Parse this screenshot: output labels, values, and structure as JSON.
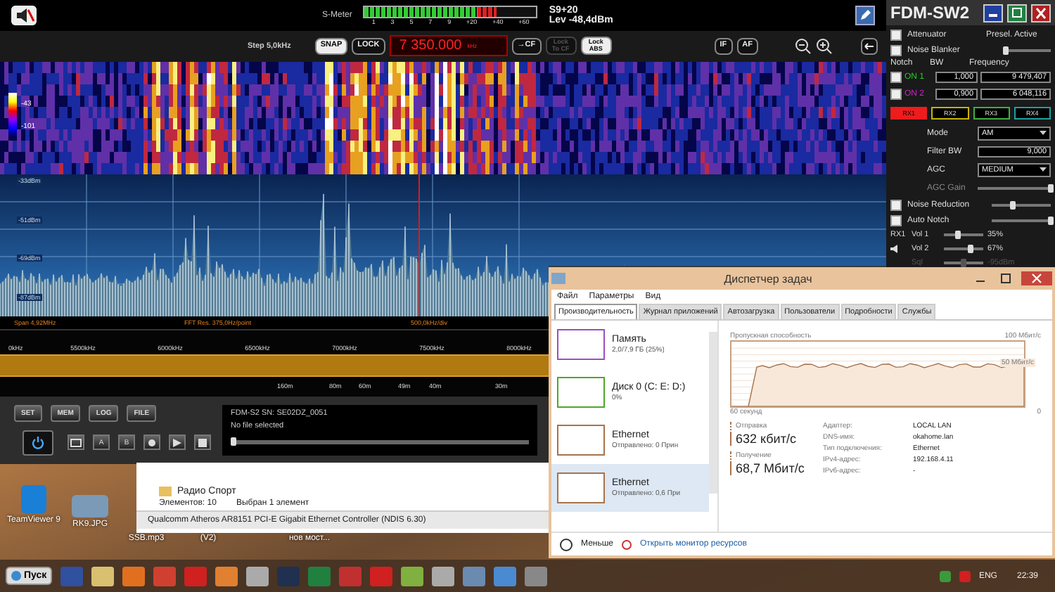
{
  "sdr": {
    "meter": {
      "label": "S-Meter",
      "level": 0.77,
      "scale": [
        "1",
        "3",
        "5",
        "7",
        "9",
        "+20",
        "+40",
        "+60"
      ],
      "reading": "S9+20",
      "level_text": "Lev -48,4dBm"
    },
    "toolbar": {
      "step": "Step 5,0kHz",
      "toggles": [
        {
          "label": "SNAP",
          "on": true
        },
        {
          "label": "LOCK",
          "on": false
        }
      ],
      "frequency": "7 350.000",
      "unit": "kHz",
      "cf_button": "→CF",
      "locks": [
        {
          "label": "Lock To CF",
          "on": false,
          "disabled": true
        },
        {
          "label": "Lock ABS",
          "on": true,
          "disabled": false
        }
      ],
      "if_button": "IF",
      "af_button": "AF"
    },
    "waterfall": {
      "legend": [
        "-43",
        "-101"
      ]
    },
    "spectrum": {
      "db_labels": [
        "-33dBm",
        "-51dBm",
        "-69dBm",
        "-87dBm"
      ],
      "span": "Span 4,92MHz",
      "fft": "FFT Res. 375,0Hz/point",
      "div": "500,0kHz/div",
      "freq_labels": [
        "0kHz",
        "5500kHz",
        "6000kHz",
        "6500kHz",
        "7000kHz",
        "7500kHz",
        "8000kHz"
      ],
      "bands": [
        "160m",
        "80m",
        "60m",
        "49m",
        "40m",
        "30m"
      ]
    },
    "controls": {
      "buttons": [
        "SET",
        "MEM",
        "LOG",
        "FILE"
      ],
      "transport": [
        "A",
        "B"
      ],
      "device": "FDM-S2 SN: SE02DZ_0051",
      "file": "No file selected",
      "playback": {
        "level": 0.0
      }
    },
    "panel": {
      "title": "FDM-SW2",
      "options": [
        {
          "label": "Attenuator",
          "checked": false
        },
        {
          "label": "Noise Blanker",
          "checked": false
        }
      ],
      "presel": {
        "label": "Presel. Active",
        "level": 0.0
      },
      "notch_headers": [
        "Notch",
        "BW",
        "Frequency"
      ],
      "notches": [
        {
          "label": "ON 1",
          "color": "#22cc22",
          "checked": false,
          "bw": "1,000",
          "frequency": "9 479,407"
        },
        {
          "label": "ON 2",
          "color": "#cc22cc",
          "checked": false,
          "bw": "0,900",
          "frequency": "6 048,116"
        }
      ],
      "receivers": [
        {
          "label": "RX1",
          "selected": true,
          "color": "#ee1c1c"
        },
        {
          "label": "RX2",
          "selected": false,
          "color": "#c8b400"
        },
        {
          "label": "RX3",
          "selected": false,
          "color": "#40b040"
        },
        {
          "label": "RX4",
          "selected": false,
          "color": "#20a0a0"
        }
      ],
      "settings": [
        {
          "label": "Mode",
          "kind": "dropdown",
          "value": "AM"
        },
        {
          "label": "Filter BW",
          "kind": "spin",
          "value": "9,000"
        },
        {
          "label": "AGC",
          "kind": "dropdown",
          "value": "MEDIUM"
        },
        {
          "label": "AGC Gain",
          "kind": "slider",
          "level": 1.0
        }
      ],
      "filters": [
        {
          "label": "Noise Reduction",
          "checked": false,
          "level": 0.35
        },
        {
          "label": "Auto Notch",
          "checked": false,
          "level": 1.0
        }
      ],
      "audio": {
        "receiver": "RX1",
        "rows": [
          {
            "label": "Vol 1",
            "level": 0.35,
            "reading": "35%",
            "disabled": false
          },
          {
            "label": "Vol 2",
            "level": 0.67,
            "reading": "67%",
            "disabled": false
          },
          {
            "label": "Sql",
            "level": 0.5,
            "reading": "-95dBm",
            "disabled": true
          }
        ]
      }
    }
  },
  "explorer": {
    "item": "Радио Спорт",
    "status": [
      "Элементов: 10",
      "Выбран 1 элемент"
    ],
    "description": "Qualcomm Atheros AR8151 PCI-E Gigabit Ethernet Controller (NDIS 6.30)"
  },
  "desktop_icons": [
    {
      "label": "TeamViewer 9",
      "kind": "app"
    },
    {
      "label": "RK9.JPG",
      "kind": "photo"
    },
    {
      "label": "SSB.mp3"
    },
    {
      "label": "(V2)"
    },
    {
      "label": "нов мост..."
    }
  ],
  "task_manager": {
    "title": "Диспетчер задач",
    "menu": [
      "Файл",
      "Параметры",
      "Вид"
    ],
    "tabs": [
      {
        "label": "Производительность",
        "selected": true
      },
      {
        "label": "Журнал приложений",
        "selected": false
      },
      {
        "label": "Автозагрузка",
        "selected": false
      },
      {
        "label": "Пользователи",
        "selected": false
      },
      {
        "label": "Подробности",
        "selected": false
      },
      {
        "label": "Службы",
        "selected": false
      }
    ],
    "resources": [
      {
        "name": "Память",
        "detail": "2,0/7,9 ГБ (25%)",
        "color": "#9b4fbf",
        "selected": false
      },
      {
        "name": "Диск 0 (C: E: D:)",
        "detail": "0%",
        "color": "#4ea72a",
        "selected": false
      },
      {
        "name": "Ethernet",
        "detail": "Отправлено: 0 Прин",
        "color": "#a8724a",
        "selected": false
      },
      {
        "name": "Ethernet",
        "detail": "Отправлено: 0,6 При",
        "color": "#a8724a",
        "selected": true
      }
    ],
    "graph": {
      "title": "Пропускная способность",
      "max": "100 Мбит/с",
      "mid": "50 Мбит/с",
      "time": "60 секунд",
      "zero": "0"
    },
    "send": {
      "label": "Отправка",
      "value": "632 кбит/с"
    },
    "receive": {
      "label": "Получение",
      "value": "68,7 Мбит/с"
    },
    "properties": [
      {
        "label": "Адаптер:",
        "value": "LOCAL LAN"
      },
      {
        "label": "DNS-имя:",
        "value": "okahome.lan"
      },
      {
        "label": "Тип подключения:",
        "value": "Ethernet"
      },
      {
        "label": "IPv4-адрес:",
        "value": "192.168.4.11"
      },
      {
        "label": "IPv6-адрес:",
        "value": "-"
      }
    ],
    "less": "Меньше",
    "monitor_link": "Открыть монитор ресурсов"
  },
  "taskbar": {
    "start": "Пуск",
    "language": "ENG",
    "time": "22:39"
  }
}
